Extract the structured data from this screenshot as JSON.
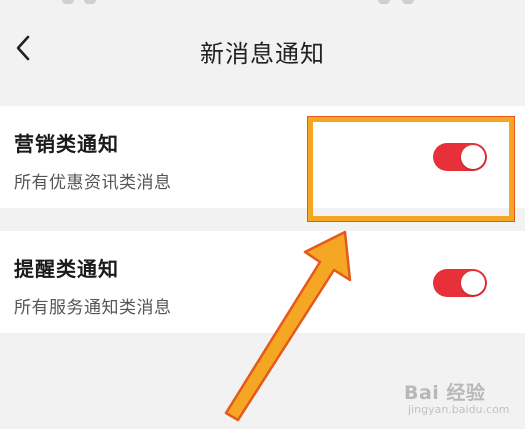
{
  "header": {
    "title": "新消息通知",
    "back_icon": "chevron-left-icon"
  },
  "settings": [
    {
      "title": "营销类通知",
      "description": "所有优惠资讯类消息",
      "enabled": true
    },
    {
      "title": "提醒类通知",
      "description": "所有服务通知类消息",
      "enabled": true
    }
  ],
  "watermark": {
    "brand": "Bai 经验",
    "url": "jingyan.baidu.com"
  },
  "colors": {
    "toggle_on": "#e8303a",
    "highlight": "#f5a623",
    "arrow": "#f5a623",
    "arrow_outline": "#e45a1c",
    "background": "#f2f2f2"
  }
}
